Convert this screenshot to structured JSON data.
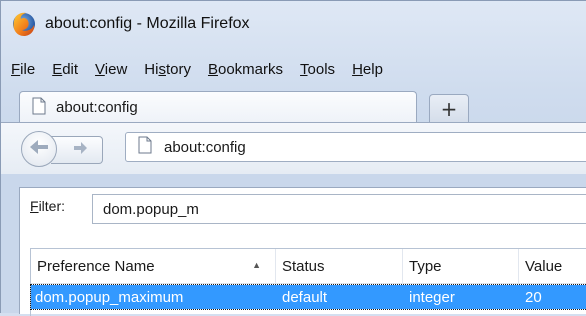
{
  "window": {
    "title": "about:config - Mozilla Firefox"
  },
  "menubar": {
    "items": [
      {
        "label": "File",
        "accesskey": "F",
        "rest": "ile"
      },
      {
        "label": "Edit",
        "accesskey": "E",
        "rest": "dit"
      },
      {
        "label": "View",
        "accesskey": "V",
        "rest": "iew"
      },
      {
        "label": "History",
        "pre": "Hi",
        "accesskey": "s",
        "rest": "tory"
      },
      {
        "label": "Bookmarks",
        "accesskey": "B",
        "rest": "ookmarks"
      },
      {
        "label": "Tools",
        "accesskey": "T",
        "rest": "ools"
      },
      {
        "label": "Help",
        "accesskey": "H",
        "rest": "elp"
      }
    ]
  },
  "tabs": [
    {
      "label": "about:config",
      "icon": "page-icon",
      "selected": true
    }
  ],
  "newtab": {
    "label": "+"
  },
  "navbar": {
    "url": "about:config"
  },
  "filter": {
    "label_accesskey": "F",
    "label_rest": "ilter:",
    "value": "dom.popup_m"
  },
  "table": {
    "columns": [
      "Preference Name",
      "Status",
      "Type",
      "Value"
    ],
    "sort_indicator": "▲",
    "rows": [
      {
        "name": "dom.popup_maximum",
        "status": "default",
        "type": "integer",
        "value": "20",
        "selected": true
      }
    ]
  },
  "colors": {
    "selection": "#3399ff",
    "chrome": "#cfdcee"
  }
}
